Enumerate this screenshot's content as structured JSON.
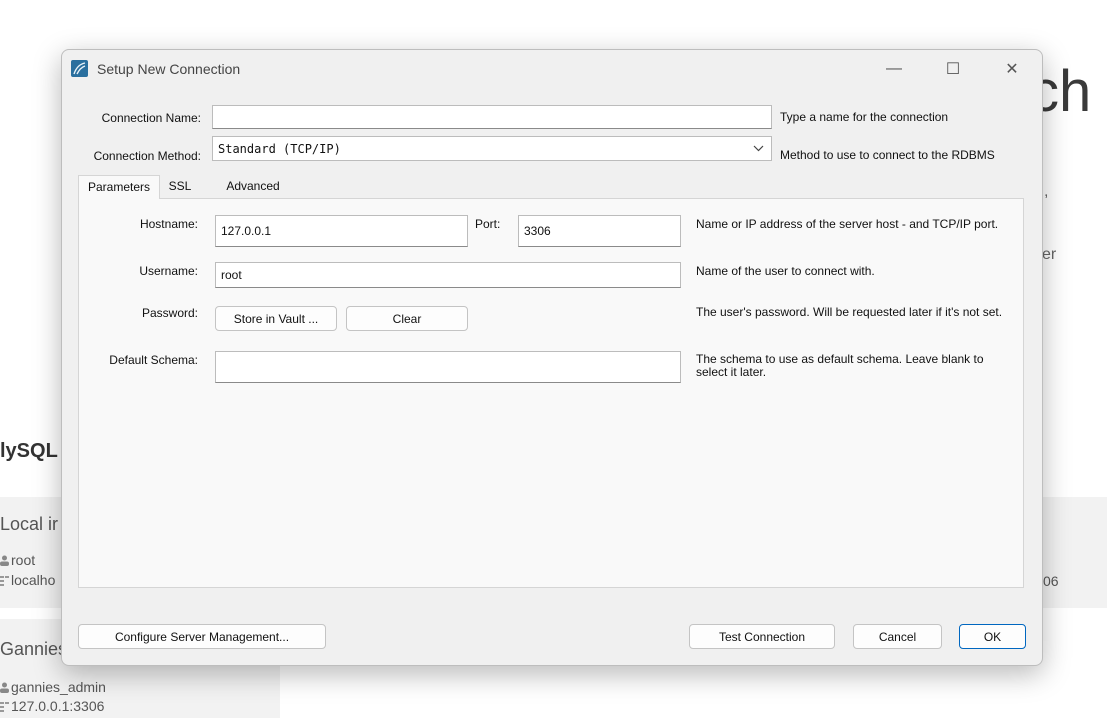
{
  "background": {
    "big_title_fragment": "ch",
    "side_fragment_1": ",",
    "side_fragment_2": "er",
    "section_heading": "lySQL",
    "tile1": {
      "title": "Local ir",
      "user": "root",
      "host": "localho",
      "port_fragment": "06"
    },
    "tile2": {
      "title": "Gannies",
      "user": "gannies_admin",
      "host": "127.0.0.1:3306"
    }
  },
  "dialog": {
    "title": "Setup New Connection",
    "window_controls": {
      "minimize": "—",
      "maximize": "☐",
      "close": "✕"
    },
    "connection_name": {
      "label": "Connection Name:",
      "value": "",
      "hint": "Type a name for the connection"
    },
    "connection_method": {
      "label": "Connection Method:",
      "value": "Standard (TCP/IP)",
      "hint": "Method to use to connect to the RDBMS"
    },
    "tabs": [
      "Parameters",
      "SSL",
      "Advanced"
    ],
    "params": {
      "hostname": {
        "label": "Hostname:",
        "value": "127.0.0.1"
      },
      "port": {
        "label": "Port:",
        "value": "3306"
      },
      "host_hint": "Name or IP address of the server host - and TCP/IP port.",
      "username": {
        "label": "Username:",
        "value": "root",
        "hint": "Name of the user to connect with."
      },
      "password": {
        "label": "Password:",
        "store_button": "Store in Vault ...",
        "clear_button": "Clear",
        "hint": "The user's password. Will be requested later if it's not set."
      },
      "default_schema": {
        "label": "Default Schema:",
        "value": "",
        "hint": "The schema to use as default schema. Leave blank to select it later."
      }
    },
    "footer": {
      "configure_button": "Configure Server Management...",
      "test_button": "Test Connection",
      "cancel_button": "Cancel",
      "ok_button": "OK"
    }
  },
  "colors": {
    "accent": "#0067c0",
    "dialog_bg": "#f0f0f0",
    "panel_bg": "#f9f9f9"
  }
}
